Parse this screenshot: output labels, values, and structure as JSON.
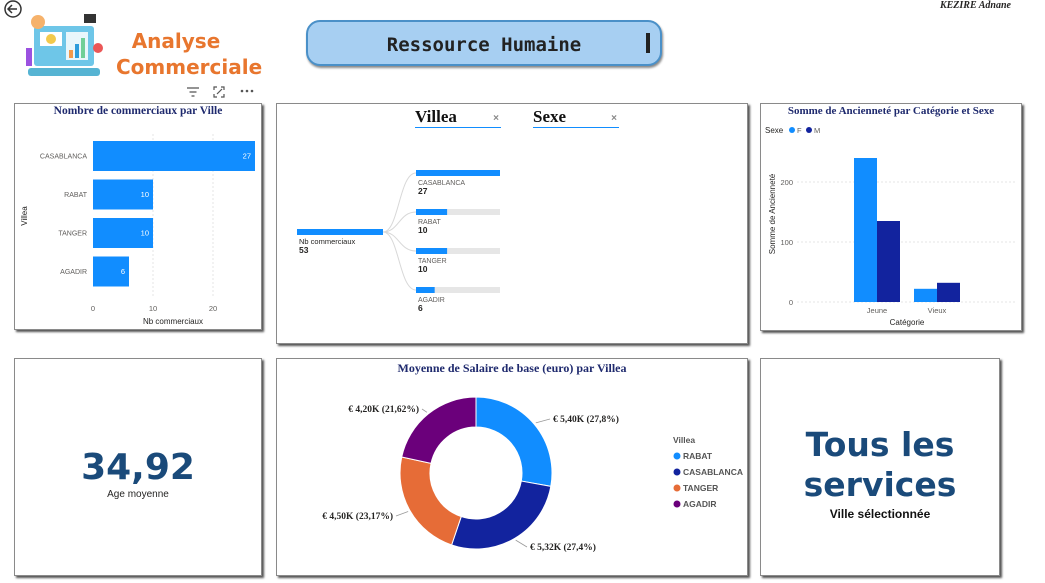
{
  "author": "KEZIRE Adnane",
  "logo": {
    "line1": "Analyse",
    "line2": "Commerciale",
    "icon": "analytics-illustration"
  },
  "header": {
    "title": "Ressource Humaine"
  },
  "back_icon": "back-arrow-icon",
  "visual_header_icons": [
    "filter-icon",
    "focus-mode-icon",
    "more-options-icon"
  ],
  "colors": {
    "blue": "#118DFF",
    "navy": "#12239E",
    "orange": "#E66C37",
    "purple": "#6B007B",
    "title": "#1f2a6e",
    "kpi": "#1a4a7a"
  },
  "bar_ville": {
    "title": "Nombre de commerciaux par Ville",
    "ylabel": "Villea",
    "xlabel": "Nb commerciaux",
    "x_ticks": [
      "0",
      "10",
      "20"
    ]
  },
  "decomp": {
    "slicer1_label": "Villea",
    "slicer2_label": "Sexe",
    "root_label": "Nb commerciaux",
    "root_value": "53",
    "nodes": [
      {
        "label": "CASABLANCA",
        "value": "27"
      },
      {
        "label": "RABAT",
        "value": "10"
      },
      {
        "label": "TANGER",
        "value": "10"
      },
      {
        "label": "AGADIR",
        "value": "6"
      }
    ]
  },
  "anc_chart": {
    "title": "Somme de Ancienneté par Catégorie et Sexe",
    "legend_title": "Sexe",
    "ylabel": "Somme de Ancienneté",
    "xlabel": "Catégorie",
    "y_ticks": [
      "0",
      "100",
      "200"
    ]
  },
  "kpi": {
    "value": "34,92",
    "label": "Age moyenne"
  },
  "donut": {
    "title": "Moyenne de Salaire de base (euro) par Villea",
    "legend_title": "Villea"
  },
  "card_services": {
    "line1": "Tous les",
    "line2": "services",
    "label": "Ville sélectionnée"
  },
  "chart_data": [
    {
      "type": "bar",
      "orientation": "horizontal",
      "title": "Nombre de commerciaux par Ville",
      "xlabel": "Nb commerciaux",
      "ylabel": "Villea",
      "categories": [
        "CASABLANCA",
        "RABAT",
        "TANGER",
        "AGADIR"
      ],
      "values": [
        27,
        10,
        10,
        6
      ],
      "xlim": [
        0,
        27
      ]
    },
    {
      "type": "bar",
      "title": "Somme de Ancienneté par Catégorie et Sexe",
      "xlabel": "Catégorie",
      "ylabel": "Somme de Ancienneté",
      "categories": [
        "Jeune",
        "Vieux"
      ],
      "series": [
        {
          "name": "F",
          "values": [
            240,
            22
          ]
        },
        {
          "name": "M",
          "values": [
            135,
            32
          ]
        }
      ],
      "ylim": [
        0,
        250
      ],
      "legend": "top-left"
    },
    {
      "type": "pie",
      "title": "Moyenne de Salaire de base (euro) par Villea",
      "categories": [
        "RABAT",
        "CASABLANCA",
        "TANGER",
        "AGADIR"
      ],
      "values": [
        5.4,
        5.32,
        4.5,
        4.2
      ],
      "labels": [
        "€ 5,40K (27,8%)",
        "€ 5,32K (27,4%)",
        "€ 4,50K (23,17%)",
        "€ 4,20K (21,62%)"
      ],
      "legend": "right"
    }
  ]
}
